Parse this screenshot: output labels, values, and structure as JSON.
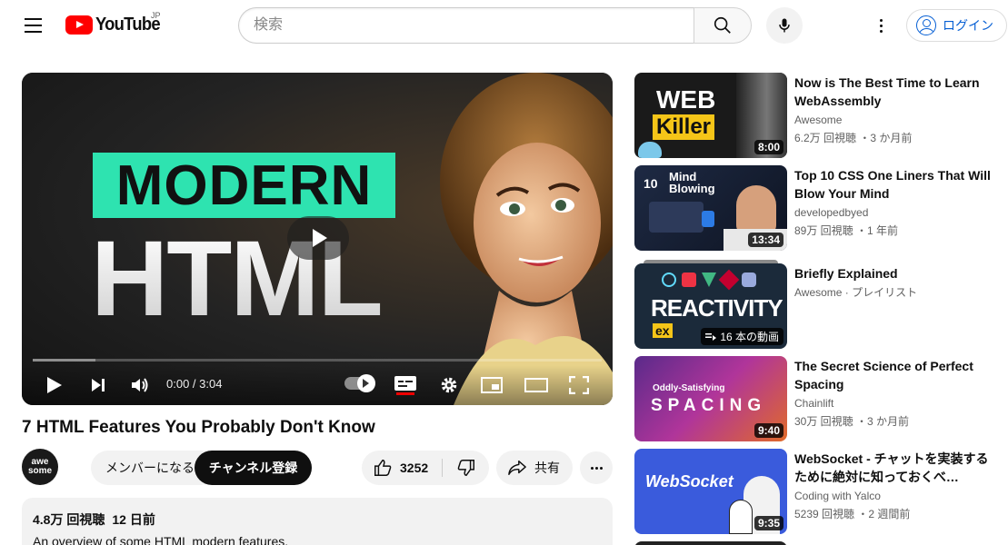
{
  "header": {
    "logo_text": "YouTube",
    "region": "JP",
    "search_placeholder": "検索",
    "login_label": "ログイン"
  },
  "player": {
    "thumb_badge": "MODERN",
    "thumb_big": "HTML",
    "time": "0:00 / 3:04",
    "progress": 0.11
  },
  "video": {
    "title": "7 HTML Features You Probably Don't Know",
    "channel_avatar_line1": "awe",
    "channel_avatar_line2": "some",
    "member_label": "メンバーになる",
    "subscribe_label": "チャンネル登録",
    "like_count": "3252",
    "share_label": "共有",
    "views": "4.8万 回視聴",
    "age": "12 日前",
    "description": "An overview of some HTML modern features."
  },
  "recommendations": [
    {
      "title": "Now is The Best Time to Learn WebAssembly",
      "channel": "Awesome",
      "stats": "6.2万 回視聴 ・3 か月前",
      "duration": "8:00",
      "thumb_text1": "WEB",
      "thumb_text2": "Killer",
      "accent": "#f5c518"
    },
    {
      "title": "Top 10 CSS One Liners That Will Blow Your Mind",
      "channel": "developedbyed",
      "stats": "89万 回視聴 ・1 年前",
      "duration": "13:34",
      "thumb_text1": "Mind",
      "thumb_text2": "Blowing",
      "thumb_num": "10",
      "accent": "#1e2a44"
    },
    {
      "title": "Briefly Explained",
      "channel": "Awesome · プレイリスト",
      "stats": "",
      "playlist_count": "16 本の動画",
      "thumb_text1": "REACTIVITY",
      "thumb_text2": "ex",
      "accent": "#1b2a3a"
    },
    {
      "title": "The Secret Science of Perfect Spacing",
      "channel": "Chainlift",
      "stats": "30万 回視聴 ・3 か月前",
      "duration": "9:40",
      "thumb_text1": "Oddly-Satisfying",
      "thumb_text2": "SPACING",
      "accent": "#b0359a"
    },
    {
      "title": "WebSocket - チャットを実装するために絶対に知っておくべ…",
      "channel": "Coding with Yalco",
      "stats": "5239 回視聴 ・2 週間前",
      "duration": "9:35",
      "thumb_text1": "WebSocket",
      "accent": "#3a5bdc"
    }
  ]
}
